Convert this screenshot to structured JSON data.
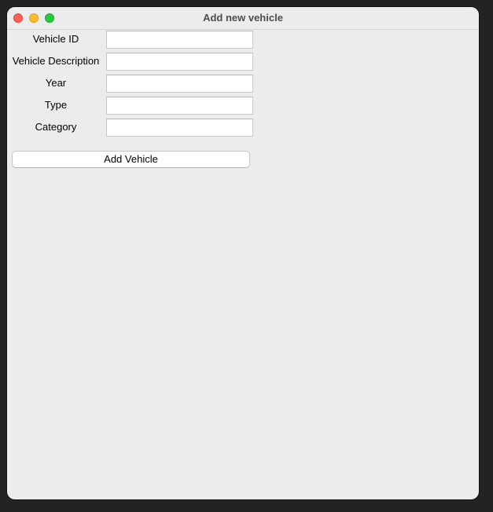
{
  "window": {
    "title": "Add new vehicle"
  },
  "form": {
    "fields": [
      {
        "label": "Vehicle ID",
        "value": "",
        "placeholder": ""
      },
      {
        "label": "Vehicle Description",
        "value": "",
        "placeholder": ""
      },
      {
        "label": "Year",
        "value": "",
        "placeholder": ""
      },
      {
        "label": "Type",
        "value": "",
        "placeholder": ""
      },
      {
        "label": "Category",
        "value": "",
        "placeholder": ""
      }
    ],
    "submit_label": "Add Vehicle"
  },
  "colors": {
    "window_bg": "#ececec",
    "close": "#fe5f57",
    "minimize": "#febc2e",
    "zoom": "#28c840"
  }
}
